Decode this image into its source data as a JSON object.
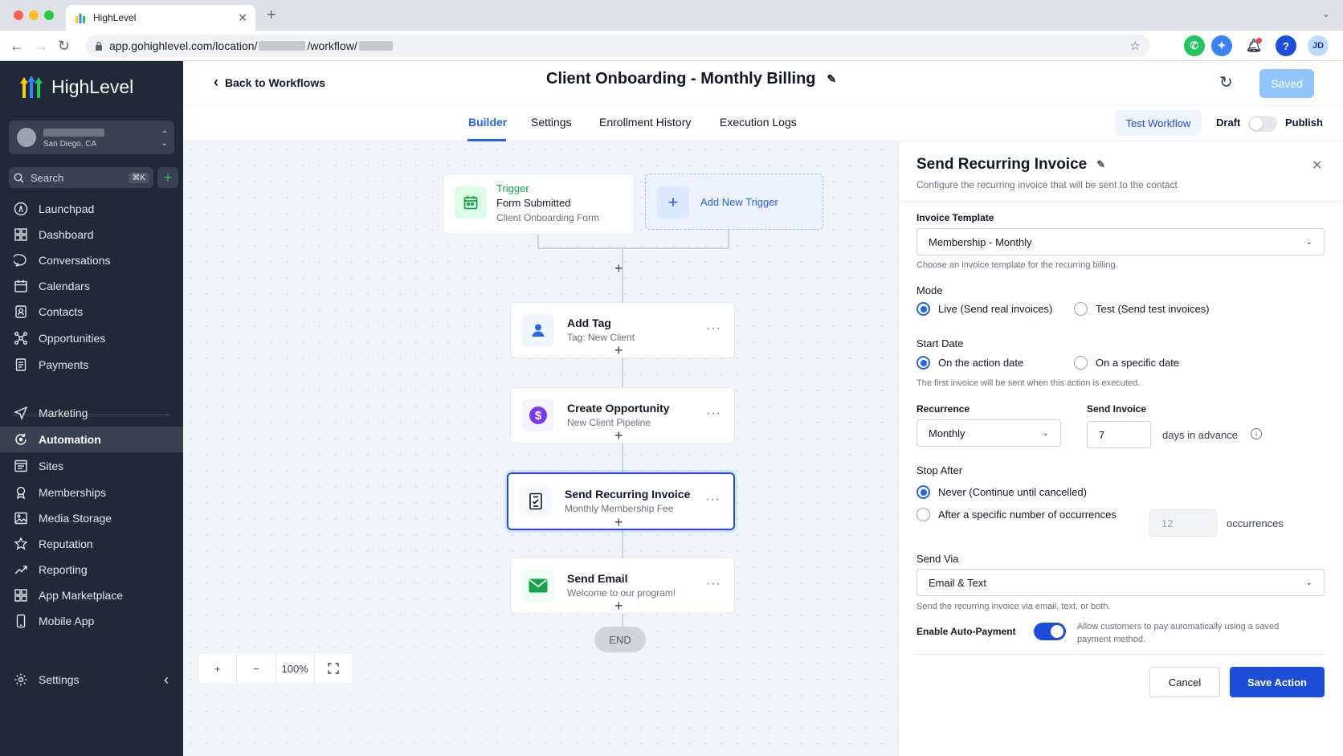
{
  "browser": {
    "tab_title": "HighLevel",
    "url_prefix": "app.gohighlevel.com/location/",
    "url_mid": "/workflow/",
    "avatar_initials": "JD"
  },
  "sidebar": {
    "brand": "HighLevel",
    "account_location": "San Diego, CA",
    "search_placeholder": "Search",
    "search_shortcut": "⌘K",
    "items": [
      {
        "label": "Launchpad",
        "icon": "launchpad-icon"
      },
      {
        "label": "Dashboard",
        "icon": "dashboard-icon"
      },
      {
        "label": "Conversations",
        "icon": "chat-icon"
      },
      {
        "label": "Calendars",
        "icon": "calendar-icon"
      },
      {
        "label": "Contacts",
        "icon": "contacts-icon"
      },
      {
        "label": "Opportunities",
        "icon": "opportunities-icon"
      },
      {
        "label": "Payments",
        "icon": "payments-icon"
      },
      {
        "label": "Marketing",
        "icon": "send-icon"
      },
      {
        "label": "Automation",
        "icon": "automation-icon",
        "active": true
      },
      {
        "label": "Sites",
        "icon": "sites-icon"
      },
      {
        "label": "Memberships",
        "icon": "memberships-icon"
      },
      {
        "label": "Media Storage",
        "icon": "image-icon"
      },
      {
        "label": "Reputation",
        "icon": "star-icon"
      },
      {
        "label": "Reporting",
        "icon": "trend-icon"
      },
      {
        "label": "App Marketplace",
        "icon": "grid-icon"
      },
      {
        "label": "Mobile App",
        "icon": "phone-icon"
      }
    ],
    "settings_label": "Settings"
  },
  "header": {
    "back_label": "Back to Workflows",
    "title": "Client Onboarding - Monthly Billing",
    "saved_label": "Saved"
  },
  "tabs": {
    "items": [
      "Builder",
      "Settings",
      "Enrollment History",
      "Execution Logs"
    ],
    "active": "Builder",
    "test_label": "Test Workflow",
    "draft_label": "Draft",
    "publish_label": "Publish"
  },
  "canvas": {
    "trigger": {
      "kind": "Trigger",
      "title": "Form Submitted",
      "subtitle": "Client Onboarding Form"
    },
    "add_trigger_label": "Add New Trigger",
    "steps": [
      {
        "title": "Add Tag",
        "subtitle": "Tag: New Client"
      },
      {
        "title": "Create Opportunity",
        "subtitle": "New Client Pipeline"
      },
      {
        "title": "Send Recurring Invoice",
        "subtitle": "Monthly Membership Fee"
      },
      {
        "title": "Send Email",
        "subtitle": "Welcome to our program!"
      }
    ],
    "end_label": "END",
    "zoom_level": "100%"
  },
  "panel": {
    "title": "Send Recurring Invoice",
    "description": "Configure the recurring invoice that will be sent to the contact",
    "invoice_template_label": "Invoice Template",
    "invoice_template_value": "Membership - Monthly",
    "invoice_template_help": "Choose an invoice template for the recurring billing.",
    "mode_label": "Mode",
    "mode_options": [
      "Live (Send real invoices)",
      "Test (Send test invoices)"
    ],
    "start_date_label": "Start Date",
    "start_date_options": [
      "On the action date",
      "On a specific date"
    ],
    "start_date_help": "The first invoice will be sent when this action is executed.",
    "recurrence_label": "Recurrence",
    "recurrence_value": "Monthly",
    "send_invoice_label": "Send Invoice",
    "send_invoice_days": "7",
    "days_in_advance": "days in advance",
    "stop_after_label": "Stop After",
    "stop_after_options": [
      "Never (Continue until cancelled)",
      "After a specific number of occurrences"
    ],
    "occurrences_value": "12",
    "occurrences_label": "occurrences",
    "send_via_label": "Send Via",
    "send_via_value": "Email & Text",
    "send_via_help": "Send the recurring invoice via email, text, or both.",
    "auto_payment_label": "Enable Auto-Payment",
    "auto_payment_help_1": "Allow customers to pay automatically using a saved",
    "auto_payment_help_2": "payment method.",
    "cancel_label": "Cancel",
    "save_label": "Save Action"
  },
  "colors": {
    "primary": "#1d4ed8",
    "sidebar_bg": "#1f2937",
    "trigger_green": "#16a34a"
  }
}
